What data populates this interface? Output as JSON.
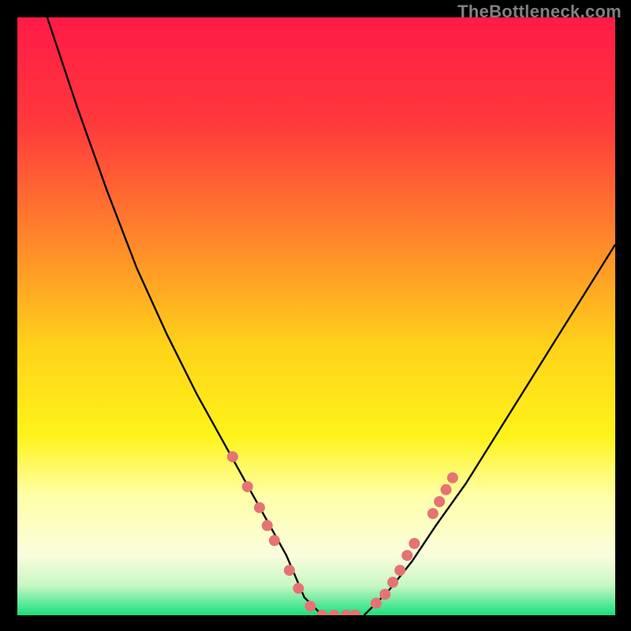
{
  "watermark": "TheBottleneck.com",
  "chart_data": {
    "type": "line",
    "title": "",
    "xlabel": "",
    "ylabel": "",
    "xlim": [
      0,
      100
    ],
    "ylim": [
      0,
      100
    ],
    "gradient_stops": [
      {
        "pct": 0,
        "color": "#ff1a46"
      },
      {
        "pct": 18,
        "color": "#ff3a3c"
      },
      {
        "pct": 38,
        "color": "#ff8a2a"
      },
      {
        "pct": 55,
        "color": "#ffd21a"
      },
      {
        "pct": 70,
        "color": "#fff31a"
      },
      {
        "pct": 80,
        "color": "#ffffa8"
      },
      {
        "pct": 90,
        "color": "#fafddd"
      },
      {
        "pct": 95,
        "color": "#c8f7c3"
      },
      {
        "pct": 100,
        "color": "#18e07e"
      }
    ],
    "series": [
      {
        "name": "left-branch",
        "x": [
          5,
          10,
          15,
          20,
          25,
          30,
          35,
          40,
          45,
          48,
          51
        ],
        "values": [
          100,
          85,
          71,
          58,
          47,
          37,
          28,
          19,
          10,
          3,
          0
        ]
      },
      {
        "name": "right-branch",
        "x": [
          58,
          62,
          66,
          70,
          75,
          80,
          85,
          90,
          95,
          100
        ],
        "values": [
          0,
          4,
          9,
          15,
          22,
          30,
          38,
          46,
          54,
          62
        ]
      }
    ],
    "markers_left": [
      {
        "x": 36.0,
        "y": 26.5
      },
      {
        "x": 38.5,
        "y": 21.5
      },
      {
        "x": 40.5,
        "y": 18.0
      },
      {
        "x": 41.8,
        "y": 15.0
      },
      {
        "x": 43.0,
        "y": 12.5
      },
      {
        "x": 45.5,
        "y": 7.5
      },
      {
        "x": 47.0,
        "y": 4.5
      },
      {
        "x": 49.0,
        "y": 1.5
      },
      {
        "x": 51.0,
        "y": 0.0
      },
      {
        "x": 53.0,
        "y": 0.0
      },
      {
        "x": 55.0,
        "y": 0.0
      },
      {
        "x": 56.5,
        "y": 0.0
      }
    ],
    "markers_right": [
      {
        "x": 60.0,
        "y": 2.0
      },
      {
        "x": 61.5,
        "y": 3.5
      },
      {
        "x": 62.8,
        "y": 5.5
      },
      {
        "x": 64.0,
        "y": 7.5
      },
      {
        "x": 65.2,
        "y": 10.0
      },
      {
        "x": 66.4,
        "y": 12.0
      },
      {
        "x": 69.5,
        "y": 17.0
      },
      {
        "x": 70.6,
        "y": 19.0
      },
      {
        "x": 71.7,
        "y": 21.0
      },
      {
        "x": 72.8,
        "y": 23.0
      }
    ],
    "marker_color": "#e57373",
    "curve_color": "#050505"
  }
}
